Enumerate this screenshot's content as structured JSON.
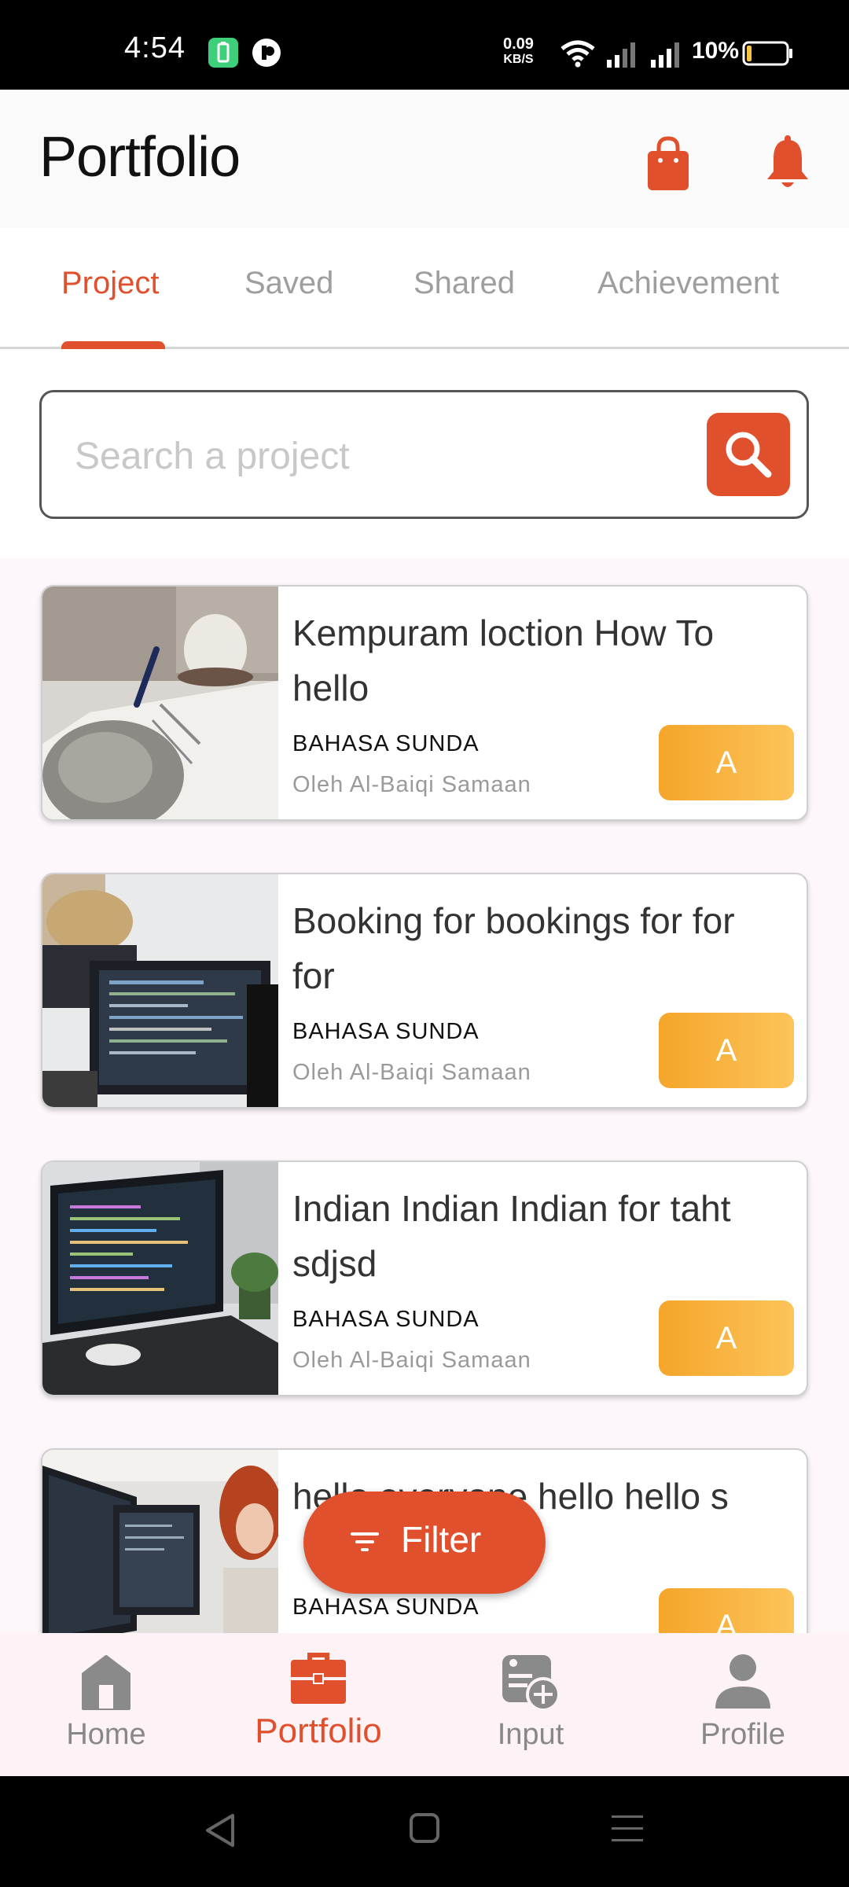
{
  "status_bar": {
    "time": "4:54",
    "net_speed_value": "0.09",
    "net_speed_unit": "KB/S",
    "battery_percent": "10%"
  },
  "header": {
    "title": "Portfolio",
    "icons": [
      "shopping-bag-icon",
      "bell-icon"
    ]
  },
  "tabs": [
    {
      "label": "Project",
      "active": true
    },
    {
      "label": "Saved",
      "active": false
    },
    {
      "label": "Shared",
      "active": false
    },
    {
      "label": "Achievement",
      "active": false
    }
  ],
  "search": {
    "placeholder": "Search a project",
    "value": ""
  },
  "projects": [
    {
      "title": "Kempuram loction How To hello",
      "subject": "BAHASA SUNDA",
      "author": "Oleh Al-Baiqi Samaan",
      "grade": "A"
    },
    {
      "title": "Booking for bookings for for for",
      "subject": "BAHASA SUNDA",
      "author": "Oleh Al-Baiqi Samaan",
      "grade": "A"
    },
    {
      "title": "Indian Indian Indian for taht sdjsd",
      "subject": "BAHASA SUNDA",
      "author": "Oleh Al-Baiqi Samaan",
      "grade": "A"
    },
    {
      "title": "hello everyone hello hello s",
      "subject": "BAHASA SUNDA",
      "author": "",
      "grade": "A"
    }
  ],
  "filter_button": {
    "label": "Filter"
  },
  "bottom_nav": [
    {
      "label": "Home",
      "icon": "home-icon",
      "active": false
    },
    {
      "label": "Portfolio",
      "icon": "briefcase-icon",
      "active": true
    },
    {
      "label": "Input",
      "icon": "add-document-icon",
      "active": false
    },
    {
      "label": "Profile",
      "icon": "person-icon",
      "active": false
    }
  ],
  "colors": {
    "accent": "#e0502d",
    "grade_gradient_start": "#f5a52a",
    "grade_gradient_end": "#fcc45a",
    "inactive": "#9e9e9e"
  }
}
